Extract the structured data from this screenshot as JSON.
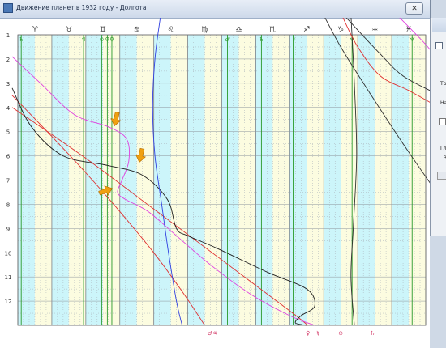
{
  "window": {
    "title_prefix": "Движение планет в ",
    "title_year": "1932 году",
    "title_sep": " - ",
    "title_mode": "Долгота",
    "close_label": "✕"
  },
  "chart_data": {
    "type": "line",
    "x_axis": {
      "labels": [
        "♈",
        "♉",
        "♊",
        "♋",
        "♌",
        "♍",
        "♎",
        "♏",
        "♐",
        "♑",
        "♒",
        "♓"
      ],
      "range": [
        0,
        360
      ],
      "unit": "degrees of ecliptic longitude, 30 per sign"
    },
    "y_axis": {
      "labels": [
        "1",
        "2",
        "3",
        "4",
        "5",
        "6",
        "7",
        "8",
        "9",
        "10",
        "11",
        "12"
      ],
      "range": [
        1,
        13
      ],
      "unit": "month"
    },
    "grid": true,
    "colors": {
      "cyan_band": "#ccf5fa",
      "yellow_band": "#fcfce0",
      "grid": "#a8b0b8",
      "green_marker": "#2a9a2a",
      "sun": "#e03030",
      "mercury": "#202020",
      "venus": "#e040e0",
      "mars": "#3040e0",
      "saturn": "#e03030",
      "uranus": "#303030",
      "arrow": "#f0a010"
    },
    "top_markers": [
      {
        "symbol": "♄",
        "lon": 3
      },
      {
        "symbol": "♃",
        "lon": 58
      },
      {
        "symbol": "⊙",
        "lon": 74
      },
      {
        "symbol": "♀",
        "lon": 79
      },
      {
        "symbol": "♀",
        "lon": 83
      },
      {
        "symbol": "♂",
        "lon": 185
      },
      {
        "symbol": "♄",
        "lon": 215
      },
      {
        "symbol": "☽",
        "lon": 243
      },
      {
        "symbol": "♆",
        "lon": 295
      },
      {
        "symbol": "♆",
        "lon": 348
      }
    ],
    "bottom_markers": [
      {
        "symbol": "♂♃",
        "lon": 172
      },
      {
        "symbol": "♀",
        "lon": 256
      },
      {
        "symbol": "☿",
        "lon": 265
      },
      {
        "symbol": "⊙",
        "lon": 285
      },
      {
        "symbol": "♄",
        "lon": 313
      }
    ],
    "series": [
      {
        "color_key": "sun",
        "points": [
          [
            -5,
            4.0
          ],
          [
            60,
            6.1
          ],
          [
            120,
            8.2
          ],
          [
            180,
            10.3
          ],
          [
            240,
            12.4
          ],
          [
            256,
            13.0
          ]
        ]
      },
      {
        "color_key": "sun",
        "points": [
          [
            -5,
            3.5
          ],
          [
            30,
            5.2
          ],
          [
            60,
            6.7
          ],
          [
            90,
            8.3
          ],
          [
            120,
            10.0
          ],
          [
            145,
            11.6
          ],
          [
            165,
            13.0
          ]
        ]
      },
      {
        "color_key": "venus",
        "points": [
          [
            -5,
            1.9
          ],
          [
            20,
            3.0
          ],
          [
            50,
            4.3
          ],
          [
            80,
            4.8
          ],
          [
            96,
            5.3
          ],
          [
            98,
            6.2
          ],
          [
            92,
            7.0
          ],
          [
            88,
            7.5
          ],
          [
            95,
            7.8
          ],
          [
            115,
            8.3
          ],
          [
            140,
            9.3
          ],
          [
            170,
            10.5
          ],
          [
            205,
            11.7
          ],
          [
            240,
            12.6
          ],
          [
            262,
            13.0
          ]
        ]
      },
      {
        "color_key": "venus",
        "points": [
          [
            335,
            0.2
          ],
          [
            360,
            1.4
          ],
          [
            368,
            1.9
          ]
        ]
      },
      {
        "color_key": "mercury",
        "points": [
          [
            -5,
            3.2
          ],
          [
            12,
            4.8
          ],
          [
            40,
            6.0
          ],
          [
            80,
            6.4
          ],
          [
            110,
            6.8
          ],
          [
            132,
            7.8
          ],
          [
            140,
            9.0
          ],
          [
            150,
            9.3
          ],
          [
            175,
            9.8
          ],
          [
            220,
            10.8
          ],
          [
            255,
            11.5
          ],
          [
            262,
            12.2
          ],
          [
            250,
            12.6
          ],
          [
            245,
            12.9
          ],
          [
            255,
            13.0
          ]
        ]
      },
      {
        "color_key": "uranus",
        "points": [
          [
            270,
            0.2
          ],
          [
            285,
            1.5
          ],
          [
            305,
            3.0
          ],
          [
            340,
            5.5
          ],
          [
            368,
            7.4
          ]
        ]
      },
      {
        "color_key": "uranus",
        "points": [
          [
            290,
            0.3
          ],
          [
            320,
            1.8
          ],
          [
            340,
            2.7
          ],
          [
            368,
            3.4
          ]
        ]
      },
      {
        "color_key": "uranus",
        "points": [
          [
            294,
            0.2
          ],
          [
            297,
            3.0
          ],
          [
            299,
            6.0
          ],
          [
            296,
            9.0
          ],
          [
            294,
            11.0
          ],
          [
            297,
            13.0
          ]
        ]
      },
      {
        "color_key": "saturn",
        "points": [
          [
            286,
            0.2
          ],
          [
            300,
            1.5
          ],
          [
            320,
            2.7
          ],
          [
            345,
            3.3
          ],
          [
            368,
            3.9
          ]
        ]
      },
      {
        "color_key": "mars",
        "points": [
          [
            126,
            0.2
          ],
          [
            121,
            2.0
          ],
          [
            119,
            4.0
          ],
          [
            121,
            6.0
          ],
          [
            127,
            8.0
          ],
          [
            133,
            10.0
          ],
          [
            140,
            12.0
          ],
          [
            145,
            13.0
          ]
        ]
      }
    ],
    "arrows": [
      {
        "lon": 86,
        "month": 4.6,
        "dir": "down"
      },
      {
        "lon": 108,
        "month": 6.1,
        "dir": "down"
      },
      {
        "lon": 80,
        "month": 7.4,
        "dir": "right-up"
      }
    ]
  },
  "side_panel": {
    "labels": [
      "Тр",
      "На",
      "Гл",
      "З"
    ]
  }
}
